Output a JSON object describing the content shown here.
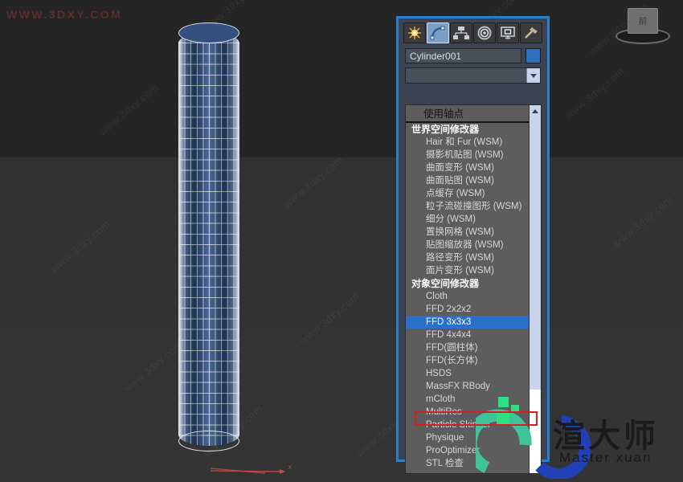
{
  "watermark": {
    "top_left": "WWW.3DXY.COM",
    "tiles": [
      "www.3dxy.com",
      "www.3dxy.com",
      "www.3dxy.com",
      "www.3dxy.com",
      "www.3dxy.com",
      "www.3dxy.com",
      "www.3dxy.com",
      "www.3dxy.com",
      "www.3dxy.com",
      "www.3dxy.com",
      "www.3dxy.com",
      "www.3dxy.com"
    ]
  },
  "viewport": {
    "object_name": "Cylinder001",
    "viewcube_label": "前"
  },
  "panel": {
    "tabs": [
      {
        "name": "create-tab",
        "icon": "sun-icon",
        "active": false
      },
      {
        "name": "modify-tab",
        "icon": "arc-icon",
        "active": true
      },
      {
        "name": "hierarchy-tab",
        "icon": "hierarchy-icon",
        "active": false
      },
      {
        "name": "motion-tab",
        "icon": "wheel-icon",
        "active": false
      },
      {
        "name": "display-tab",
        "icon": "monitor-icon",
        "active": false
      },
      {
        "name": "utilities-tab",
        "icon": "hammer-icon",
        "active": false
      }
    ],
    "object_name": "Cylinder001",
    "object_color": "#2f6fc0",
    "modifier_combo_value": "",
    "modifier_combo_placeholder": ""
  },
  "dropdown": {
    "top_entry": "使用轴点",
    "selected": "FFD 3x3x3",
    "items": [
      {
        "label": "世界空间修改器",
        "type": "header"
      },
      {
        "label": "Hair 和 Fur (WSM)",
        "type": "item"
      },
      {
        "label": "摄影机贴图 (WSM)",
        "type": "item"
      },
      {
        "label": "曲面变形 (WSM)",
        "type": "item"
      },
      {
        "label": "曲面贴图 (WSM)",
        "type": "item"
      },
      {
        "label": "点缓存 (WSM)",
        "type": "item"
      },
      {
        "label": "粒子流碰撞图形 (WSM)",
        "type": "item"
      },
      {
        "label": "细分 (WSM)",
        "type": "item"
      },
      {
        "label": "置换网格 (WSM)",
        "type": "item"
      },
      {
        "label": "贴图缩放器 (WSM)",
        "type": "item"
      },
      {
        "label": "路径变形 (WSM)",
        "type": "item"
      },
      {
        "label": "面片变形 (WSM)",
        "type": "item"
      },
      {
        "label": "对象空间修改器",
        "type": "header"
      },
      {
        "label": "Cloth",
        "type": "item"
      },
      {
        "label": "FFD 2x2x2",
        "type": "item"
      },
      {
        "label": "FFD 3x3x3",
        "type": "selected"
      },
      {
        "label": "FFD 4x4x4",
        "type": "item"
      },
      {
        "label": "FFD(圆柱体)",
        "type": "item"
      },
      {
        "label": "FFD(长方体)",
        "type": "item"
      },
      {
        "label": "HSDS",
        "type": "item"
      },
      {
        "label": "MassFX RBody",
        "type": "item"
      },
      {
        "label": "mCloth",
        "type": "item"
      },
      {
        "label": "MultiRes",
        "type": "item"
      },
      {
        "label": "Particle Skinner",
        "type": "item"
      },
      {
        "label": "Physique",
        "type": "item"
      },
      {
        "label": "ProOptimizer",
        "type": "item"
      },
      {
        "label": "STL 检查",
        "type": "item"
      }
    ]
  },
  "logo": {
    "text_cn": "渲大师",
    "text_en": "Master xuan"
  },
  "colors": {
    "panel_border": "#2d7ec9",
    "selection_blue": "#2a6fc9",
    "highlight_red": "#d81f1f",
    "object_blue": "#2f6fc0"
  }
}
